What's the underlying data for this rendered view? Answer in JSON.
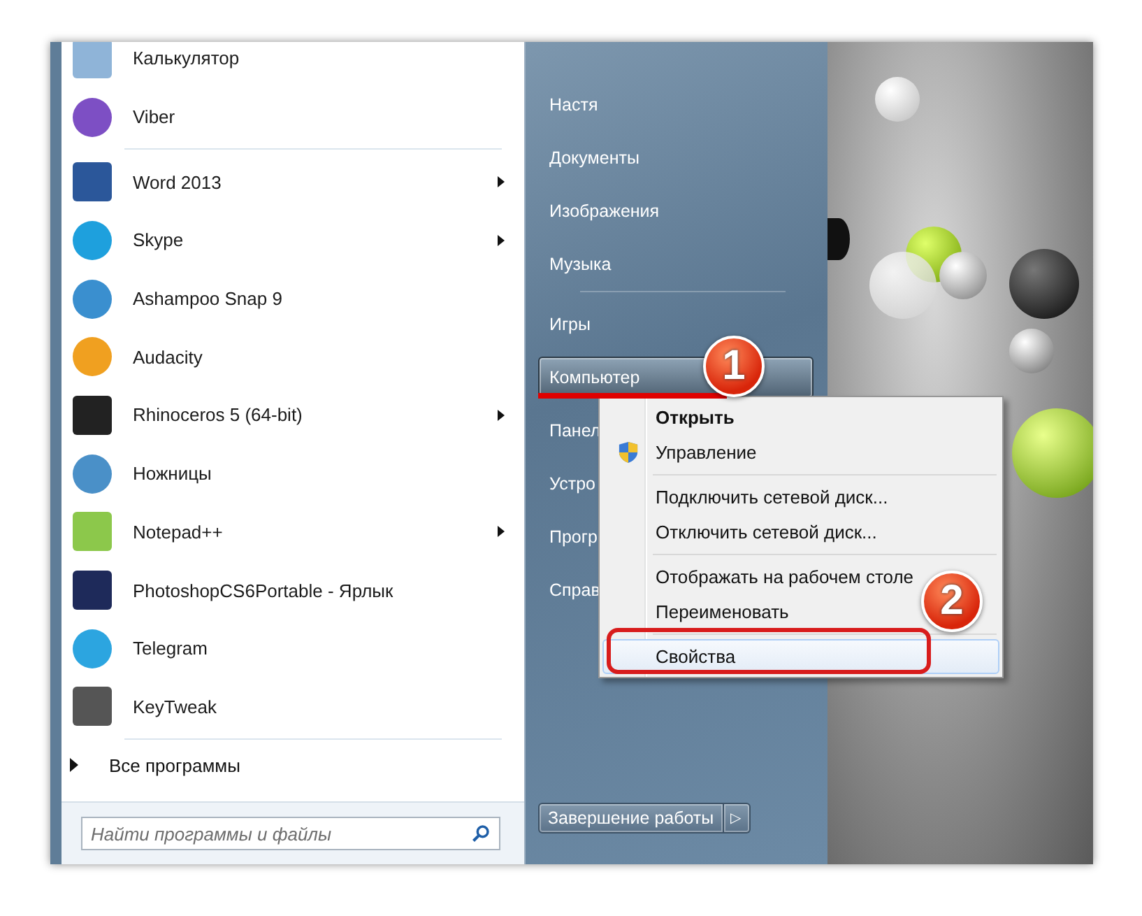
{
  "start_menu": {
    "pinned": [
      {
        "label": "Калькулятор",
        "submenu": false
      },
      {
        "label": "Viber",
        "submenu": false
      }
    ],
    "recent": [
      {
        "label": "Word 2013",
        "submenu": true
      },
      {
        "label": "Skype",
        "submenu": true
      },
      {
        "label": "Ashampoo Snap 9",
        "submenu": false
      },
      {
        "label": "Audacity",
        "submenu": false
      },
      {
        "label": "Rhinoceros 5 (64-bit)",
        "submenu": true
      },
      {
        "label": "Ножницы",
        "submenu": false
      },
      {
        "label": "Notepad++",
        "submenu": true
      },
      {
        "label": "PhotoshopCS6Portable - Ярлык",
        "submenu": false
      },
      {
        "label": "Telegram",
        "submenu": false
      },
      {
        "label": "KeyTweak",
        "submenu": false
      }
    ],
    "all_programs": "Все программы",
    "search": {
      "placeholder": "Найти программы и файлы"
    },
    "places": [
      [
        {
          "label": "Настя",
          "selected": false
        },
        {
          "label": "Документы",
          "selected": false
        },
        {
          "label": "Изображения",
          "selected": false
        },
        {
          "label": "Музыка",
          "selected": false
        }
      ],
      [
        {
          "label": "Игры",
          "selected": false
        },
        {
          "label": "Компьютер",
          "selected": true
        },
        {
          "label": "Панел",
          "selected": false
        },
        {
          "label": "Устро",
          "selected": false
        },
        {
          "label": "Прогр",
          "selected": false
        },
        {
          "label": "Справ",
          "selected": false
        }
      ]
    ],
    "shutdown": "Завершение работы",
    "shutdown_arrow": "▷"
  },
  "context_menu": [
    [
      {
        "label": "Открыть",
        "bold": true,
        "shield": false,
        "selected": false
      },
      {
        "label": "Управление",
        "bold": false,
        "shield": true,
        "selected": false
      }
    ],
    [
      {
        "label": "Подключить сетевой диск...",
        "bold": false,
        "shield": false,
        "selected": false
      },
      {
        "label": "Отключить сетевой диск...",
        "bold": false,
        "shield": false,
        "selected": false
      }
    ],
    [
      {
        "label": "Отображать на рабочем столе",
        "bold": false,
        "shield": false,
        "selected": false
      },
      {
        "label": "Переименовать",
        "bold": false,
        "shield": false,
        "selected": false
      }
    ],
    [
      {
        "label": "Свойства",
        "bold": false,
        "shield": false,
        "selected": true
      }
    ]
  ],
  "annotations": [
    {
      "number": "1"
    },
    {
      "number": "2"
    }
  ]
}
